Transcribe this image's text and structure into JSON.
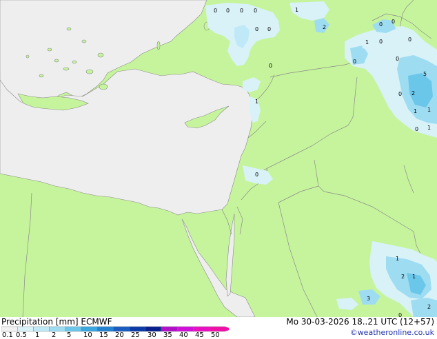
{
  "legend": {
    "title": "Precipitation [mm]",
    "model": "ECMWF",
    "ticks": [
      "0.1",
      "0.5",
      "1",
      "2",
      "5",
      "10",
      "15",
      "20",
      "25",
      "30",
      "35",
      "40",
      "45",
      "50"
    ],
    "colors": [
      "#f2f2f2",
      "#d8f2f8",
      "#bfe9f6",
      "#9edcf2",
      "#6bc7ea",
      "#3aa7e0",
      "#2582d0",
      "#1a5cc0",
      "#0c3aa8",
      "#09208c",
      "#b010c8",
      "#d010d8",
      "#e810c0",
      "#f010a8"
    ]
  },
  "valid_time": "Mo 30-03-2026 18..21 UTC (12+57)",
  "credit": "©weatheronline.co.uk",
  "colors": {
    "land": "#c6f49c",
    "sea": "#eeeeee",
    "border": "#8a8a8a"
  },
  "map_values": [
    {
      "text": "0"
    },
    {
      "text": "0"
    },
    {
      "text": "0"
    },
    {
      "text": "0"
    },
    {
      "text": "1"
    },
    {
      "text": "2"
    },
    {
      "text": "0"
    },
    {
      "text": "0"
    },
    {
      "text": "0"
    },
    {
      "text": "0"
    },
    {
      "text": "0"
    },
    {
      "text": "1"
    },
    {
      "text": "0"
    },
    {
      "text": "0"
    },
    {
      "text": "0"
    },
    {
      "text": "0"
    },
    {
      "text": "5"
    },
    {
      "text": "2"
    },
    {
      "text": "0"
    },
    {
      "text": "1"
    },
    {
      "text": "1"
    },
    {
      "text": "0"
    },
    {
      "text": "1"
    },
    {
      "text": "1"
    },
    {
      "text": "0"
    },
    {
      "text": "1"
    },
    {
      "text": "2"
    },
    {
      "text": "1"
    },
    {
      "text": "3"
    },
    {
      "text": "0"
    },
    {
      "text": "2"
    }
  ]
}
